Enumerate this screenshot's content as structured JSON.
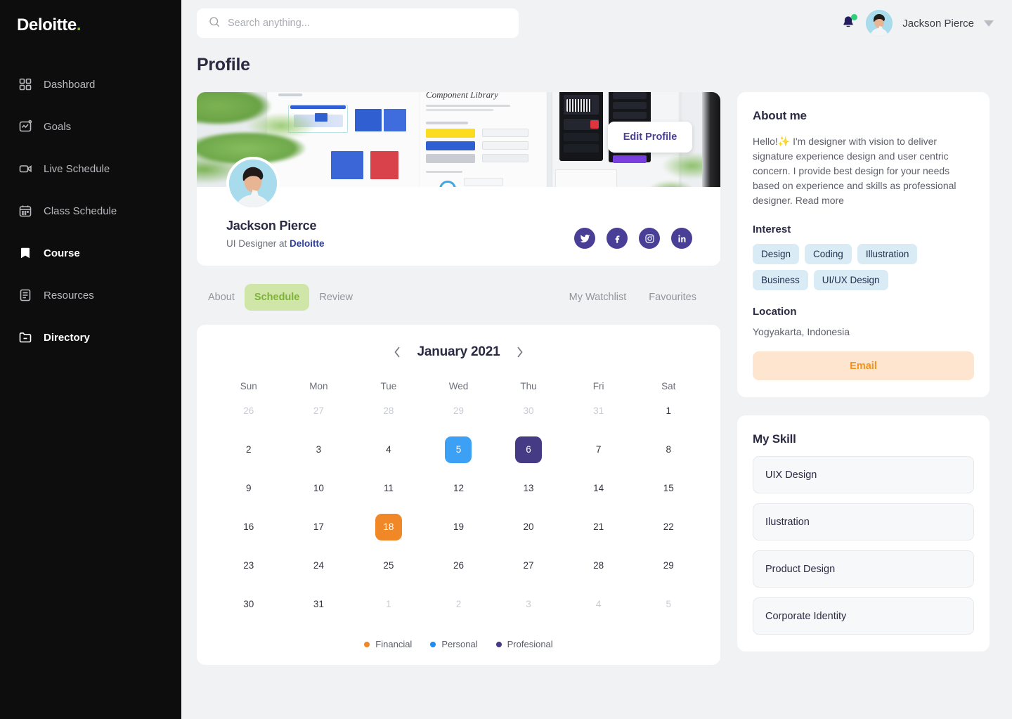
{
  "brand": {
    "name": "Deloitte",
    "dot": ".",
    "dot_color": "#86bc25"
  },
  "sidebar": {
    "items": [
      {
        "label": "Dashboard",
        "icon": "grid-icon",
        "active": false
      },
      {
        "label": "Goals",
        "icon": "chart-goal-icon",
        "active": false
      },
      {
        "label": "Live Schedule",
        "icon": "video-icon",
        "active": false
      },
      {
        "label": "Class Schedule",
        "icon": "calendar-icon",
        "active": false
      },
      {
        "label": "Course",
        "icon": "bookmark-icon",
        "active": true
      },
      {
        "label": "Resources",
        "icon": "document-icon",
        "active": false
      },
      {
        "label": "Directory",
        "icon": "folder-minus-icon",
        "active": true
      }
    ]
  },
  "topbar": {
    "search_placeholder": "Search anything...",
    "search_value": "",
    "notification_has_badge": true,
    "user_name": "Jackson Pierce"
  },
  "page": {
    "title": "Profile"
  },
  "profile": {
    "edit_button": "Edit Profile",
    "name": "Jackson Pierce",
    "role_prefix": "UI Designer at ",
    "company": "Deloitte",
    "cover_label": "Component Library",
    "socials": [
      "twitter-icon",
      "facebook-icon",
      "instagram-icon",
      "linkedin-icon"
    ],
    "social_color": "#4a3f96"
  },
  "tabs": {
    "left": [
      {
        "label": "About",
        "active": false
      },
      {
        "label": "Schedule",
        "active": true
      },
      {
        "label": "Review",
        "active": false
      }
    ],
    "right": [
      {
        "label": "My Watchlist",
        "active": false
      },
      {
        "label": "Favourites",
        "active": false
      }
    ],
    "active_bg": "#cfe6a8",
    "active_fg": "#7fb13c"
  },
  "calendar": {
    "month_label": "January 2021",
    "prev": "‹",
    "next": "›",
    "day_headers": [
      "Sun",
      "Mon",
      "Tue",
      "Wed",
      "Thu",
      "Fri",
      "Sat"
    ],
    "weeks": [
      [
        {
          "d": "26",
          "s": "muted"
        },
        {
          "d": "27",
          "s": "muted"
        },
        {
          "d": "28",
          "s": "muted"
        },
        {
          "d": "29",
          "s": "muted"
        },
        {
          "d": "30",
          "s": "muted"
        },
        {
          "d": "31",
          "s": "muted"
        },
        {
          "d": "1",
          "s": ""
        }
      ],
      [
        {
          "d": "2",
          "s": ""
        },
        {
          "d": "3",
          "s": ""
        },
        {
          "d": "4",
          "s": ""
        },
        {
          "d": "5",
          "s": "blue"
        },
        {
          "d": "6",
          "s": "purple"
        },
        {
          "d": "7",
          "s": ""
        },
        {
          "d": "8",
          "s": ""
        }
      ],
      [
        {
          "d": "9",
          "s": ""
        },
        {
          "d": "10",
          "s": ""
        },
        {
          "d": "11",
          "s": ""
        },
        {
          "d": "12",
          "s": ""
        },
        {
          "d": "13",
          "s": ""
        },
        {
          "d": "14",
          "s": ""
        },
        {
          "d": "15",
          "s": ""
        }
      ],
      [
        {
          "d": "16",
          "s": ""
        },
        {
          "d": "17",
          "s": ""
        },
        {
          "d": "18",
          "s": "orange"
        },
        {
          "d": "19",
          "s": ""
        },
        {
          "d": "20",
          "s": ""
        },
        {
          "d": "21",
          "s": ""
        },
        {
          "d": "22",
          "s": ""
        }
      ],
      [
        {
          "d": "23",
          "s": ""
        },
        {
          "d": "24",
          "s": ""
        },
        {
          "d": "25",
          "s": ""
        },
        {
          "d": "26",
          "s": ""
        },
        {
          "d": "27",
          "s": ""
        },
        {
          "d": "28",
          "s": ""
        },
        {
          "d": "29",
          "s": ""
        }
      ],
      [
        {
          "d": "30",
          "s": ""
        },
        {
          "d": "31",
          "s": ""
        },
        {
          "d": "1",
          "s": "muted"
        },
        {
          "d": "2",
          "s": "muted"
        },
        {
          "d": "3",
          "s": "muted"
        },
        {
          "d": "4",
          "s": "muted"
        },
        {
          "d": "5",
          "s": "muted"
        }
      ]
    ],
    "legend": [
      {
        "label": "Financial",
        "color": "#f08828"
      },
      {
        "label": "Personal",
        "color": "#1e8cf0"
      },
      {
        "label": "Profesional",
        "color": "#453b84"
      }
    ]
  },
  "about_me": {
    "title": "About me",
    "text": "Hello!✨ I'm designer with vision to deliver signature experience design and user centric concern. I provide best design for your needs based on experience and skills as professional designer. Read more",
    "interest_title": "Interest",
    "interests": [
      "Design",
      "Coding",
      "Illustration",
      "Business",
      "UI/UX Design"
    ],
    "location_title": "Location",
    "location": "Yogyakarta, Indonesia",
    "email_button": "Email"
  },
  "my_skill": {
    "title": "My Skill",
    "skills": [
      "UIX Design",
      "Ilustration",
      "Product Design",
      "Corporate Identity"
    ]
  }
}
